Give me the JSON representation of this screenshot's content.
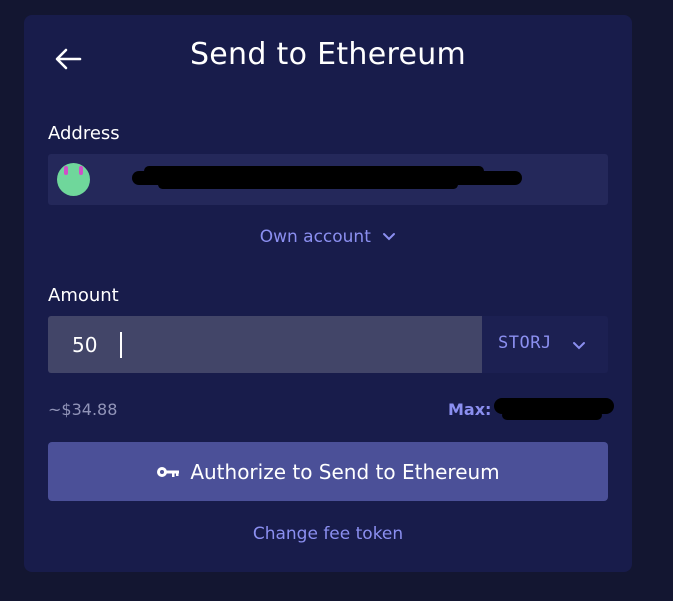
{
  "header": {
    "title": "Send to Ethereum",
    "back_icon": "arrow-left-icon"
  },
  "address": {
    "label": "Address",
    "value_redacted": true,
    "avatar_icon": "identicon-avatar",
    "own_account_label": "Own account",
    "own_account_icon": "chevron-down-icon"
  },
  "amount": {
    "label": "Amount",
    "value": "50",
    "token": "STORJ",
    "token_icon": "chevron-down-icon",
    "fiat_estimate": "~$34.88",
    "max_label": "Max:"
  },
  "actions": {
    "authorize_label": "Authorize to Send to Ethereum",
    "authorize_icon": "key-icon",
    "change_fee_label": "Change fee token"
  },
  "colors": {
    "background": "#131631",
    "card": "#181c4b",
    "accent": "#8b8ff0",
    "button": "#4b5098",
    "input": "#424568"
  }
}
